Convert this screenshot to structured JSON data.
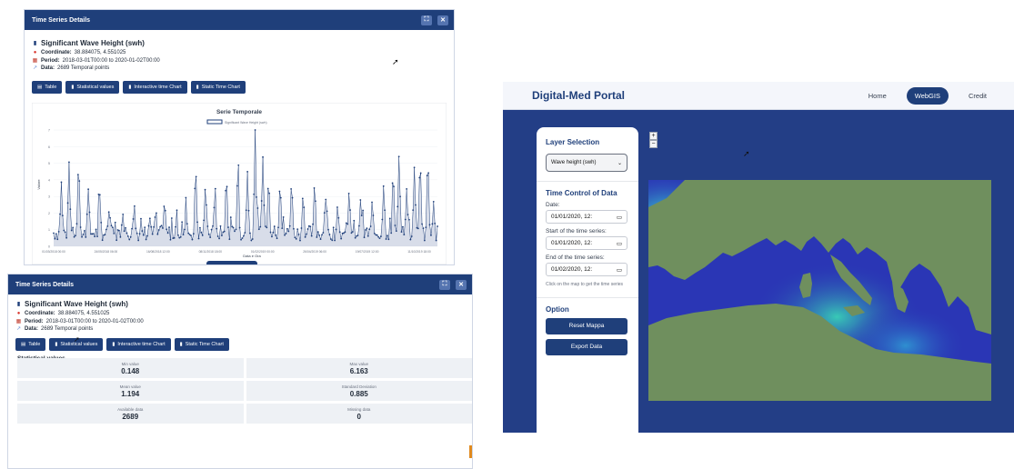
{
  "panel1": {
    "title": "Time Series Details",
    "expand_icon": "expand-icon",
    "close_icon": "close-icon",
    "variable": "Significant Wave Height (swh)",
    "coordinate_label": "Coordinate:",
    "coordinate_value": "38.884075, 4.551025",
    "period_label": "Period:",
    "period_value": "2018-03-01T00:00 to 2020-01-02T00:00",
    "data_label": "Data:",
    "data_value": "2689 Temporal points",
    "buttons": [
      "Table",
      "Statistical values",
      "Interactive time Chart",
      "Static Time Chart"
    ]
  },
  "chart_data": {
    "type": "line",
    "title": "Serie Temporale",
    "legend": "Significant Wave Height (swh)",
    "xlabel": "Data e Ora",
    "ylabel": "Valore",
    "ylim": [
      0,
      7
    ],
    "yticks": [
      0,
      1,
      2,
      3,
      4,
      5,
      6,
      7
    ],
    "xticks": [
      "01/03/2018 00:00",
      "24/05/2018 06:00",
      "16/08/2018 12:00",
      "08/11/2018 18:00",
      "01/02/2019 00:00",
      "26/04/2019 06:00",
      "19/07/2019 12:00",
      "11/10/2019 18:00"
    ],
    "series_color": "#1f3f7a",
    "fill_color": "#c7cee0",
    "peaks": [
      {
        "x": 0.02,
        "y": 3.6
      },
      {
        "x": 0.04,
        "y": 4.6
      },
      {
        "x": 0.065,
        "y": 5.3
      },
      {
        "x": 0.09,
        "y": 3.3
      },
      {
        "x": 0.12,
        "y": 3.0
      },
      {
        "x": 0.145,
        "y": 2.2
      },
      {
        "x": 0.18,
        "y": 1.8
      },
      {
        "x": 0.21,
        "y": 2.4
      },
      {
        "x": 0.25,
        "y": 1.6
      },
      {
        "x": 0.29,
        "y": 2.2
      },
      {
        "x": 0.32,
        "y": 1.4
      },
      {
        "x": 0.345,
        "y": 2.0
      },
      {
        "x": 0.37,
        "y": 4.9
      },
      {
        "x": 0.395,
        "y": 3.3
      },
      {
        "x": 0.42,
        "y": 3.0
      },
      {
        "x": 0.45,
        "y": 4.4
      },
      {
        "x": 0.48,
        "y": 4.7
      },
      {
        "x": 0.505,
        "y": 4.2
      },
      {
        "x": 0.525,
        "y": 6.2
      },
      {
        "x": 0.545,
        "y": 5.2
      },
      {
        "x": 0.56,
        "y": 4.2
      },
      {
        "x": 0.59,
        "y": 3.9
      },
      {
        "x": 0.62,
        "y": 4.0
      },
      {
        "x": 0.65,
        "y": 3.2
      },
      {
        "x": 0.68,
        "y": 3.9
      },
      {
        "x": 0.71,
        "y": 3.0
      },
      {
        "x": 0.74,
        "y": 2.4
      },
      {
        "x": 0.77,
        "y": 3.3
      },
      {
        "x": 0.8,
        "y": 2.8
      },
      {
        "x": 0.83,
        "y": 2.6
      },
      {
        "x": 0.86,
        "y": 3.6
      },
      {
        "x": 0.885,
        "y": 4.2
      },
      {
        "x": 0.9,
        "y": 5.4
      },
      {
        "x": 0.92,
        "y": 3.3
      },
      {
        "x": 0.94,
        "y": 4.6
      },
      {
        "x": 0.955,
        "y": 5.5
      },
      {
        "x": 0.975,
        "y": 5.6
      },
      {
        "x": 0.99,
        "y": 2.4
      }
    ]
  },
  "panel2": {
    "title": "Time Series Details",
    "variable": "Significant Wave Height (swh)",
    "coordinate_label": "Coordinate:",
    "coordinate_value": "38.884075, 4.551025",
    "period_label": "Period:",
    "period_value": "2018-03-01T00:00 to 2020-01-02T00:00",
    "data_label": "Data:",
    "data_value": "2689 Temporal points",
    "buttons": [
      "Table",
      "Statistical values",
      "Interactive time Chart",
      "Static Time Chart"
    ],
    "stats_heading": "Statistical values",
    "stats": [
      {
        "name": "Min value",
        "value": "0.148"
      },
      {
        "name": "Max value",
        "value": "6.163"
      },
      {
        "name": "Mean value",
        "value": "1.194"
      },
      {
        "name": "Standard Deviation",
        "value": "0.885"
      },
      {
        "name": "Available data",
        "value": "2689"
      },
      {
        "name": "Missing data",
        "value": "0"
      }
    ]
  },
  "portal": {
    "brand": "Digital-Med Portal",
    "nav": [
      "Home",
      "WebGIS",
      "Credit"
    ],
    "layer_heading": "Layer Selection",
    "layer_selected": "Wave height (swh)",
    "time_heading": "Time Control of Data",
    "date_label": "Date:",
    "date_value": "01/01/2020, 12:",
    "start_label": "Start of the time series:",
    "start_value": "01/01/2020, 12:",
    "end_label": "End of the time series:",
    "end_value": "01/02/2020, 12:",
    "help_text": "Click on the map to get the time series",
    "option_heading": "Option",
    "reset_button": "Reset Mappa",
    "export_button": "Export Data",
    "zoom_in": "+",
    "zoom_out": "−"
  },
  "colors": {
    "primary": "#1f3f7a",
    "portal_bg": "#233e86",
    "land": "#6f8f5e",
    "sea_low": "#2a36b5",
    "sea_high": "#35c4c9"
  }
}
